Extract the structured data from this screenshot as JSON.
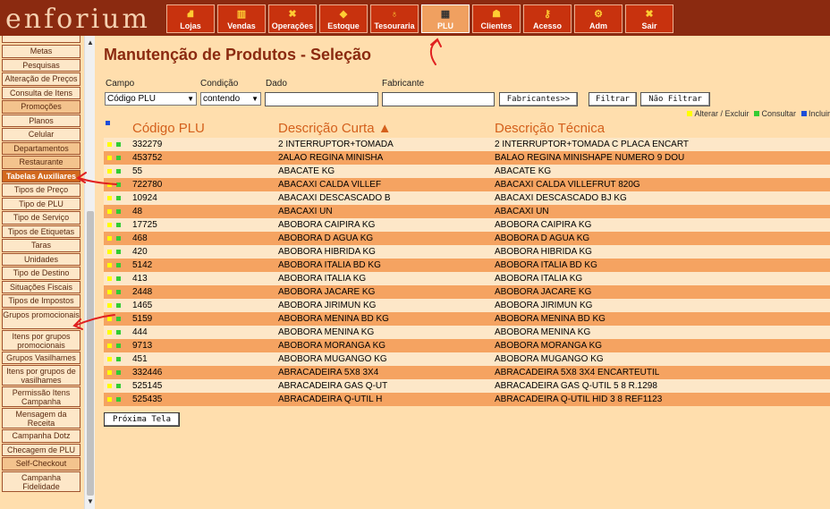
{
  "logo": "enforium",
  "nav": [
    {
      "label": "Lojas",
      "icon": "hierarchy-icon",
      "glyph": "⛘"
    },
    {
      "label": "Vendas",
      "icon": "bar-chart-icon",
      "glyph": "▥"
    },
    {
      "label": "Operações",
      "icon": "tools-icon",
      "glyph": "✖"
    },
    {
      "label": "Estoque",
      "icon": "boxes-icon",
      "glyph": "◆"
    },
    {
      "label": "Tesouraria",
      "icon": "money-bag-icon",
      "glyph": "♁"
    },
    {
      "label": "PLU",
      "icon": "barcode-icon",
      "glyph": "▦"
    },
    {
      "label": "Clientes",
      "icon": "people-icon",
      "glyph": "☗"
    },
    {
      "label": "Acesso",
      "icon": "key-icon",
      "glyph": "⚷"
    },
    {
      "label": "Adm",
      "icon": "gears-icon",
      "glyph": "⚙"
    },
    {
      "label": "Sair",
      "icon": "exit-icon",
      "glyph": "✖"
    }
  ],
  "sidebar": [
    {
      "label": "Metas"
    },
    {
      "label": "Pesquisas"
    },
    {
      "label": "Alteração de Preços"
    },
    {
      "label": "Consulta de Itens"
    },
    {
      "label": "Promoções",
      "style": "hl"
    },
    {
      "label": "Planos"
    },
    {
      "label": "Celular"
    },
    {
      "label": "Departamentos",
      "style": "hl"
    },
    {
      "label": "Restaurante",
      "style": "hl"
    },
    {
      "label": "Tabelas Auxiliares",
      "style": "sel"
    },
    {
      "label": "Tipos de Preço"
    },
    {
      "label": "Tipo de PLU"
    },
    {
      "label": "Tipo de Serviço"
    },
    {
      "label": "Tipos de Etiquetas"
    },
    {
      "label": "Taras"
    },
    {
      "label": "Unidades"
    },
    {
      "label": "Tipo de Destino"
    },
    {
      "label": "Situações Fiscais"
    },
    {
      "label": "Tipos de Impostos"
    },
    {
      "label": "Grupos promocionais",
      "tall": true
    },
    {
      "label": "Itens por grupos promocionais",
      "tall": true
    },
    {
      "label": "Grupos Vasilhames"
    },
    {
      "label": "Itens por grupos de vasilhames",
      "tall": true
    },
    {
      "label": "Permissão Itens Campanha",
      "tall": true
    },
    {
      "label": "Mensagem da Receita",
      "tall": true
    },
    {
      "label": "Campanha Dotz"
    },
    {
      "label": "Checagem de PLU"
    },
    {
      "label": "Self-Checkout",
      "style": "hl"
    },
    {
      "label": "Campanha Fidelidade",
      "tall": true
    }
  ],
  "main": {
    "title": "Manutenção de Produtos - Seleção",
    "filters": {
      "campo_label": "Campo",
      "campo_value": "Código PLU",
      "condicao_label": "Condição",
      "condicao_value": "contendo",
      "dado_label": "Dado",
      "dado_value": "",
      "fabricante_label": "Fabricante",
      "fabricante_value": "",
      "fabricantes_btn": "Fabricantes>>",
      "filtrar_btn": "Filtrar",
      "nao_filtrar_btn": "Não Filtrar"
    },
    "legend": {
      "alterar": "Alterar / Excluir",
      "consultar": "Consultar",
      "incluir": "Incluir"
    },
    "columns": [
      "Código PLU",
      "Descrição Curta ▲",
      "Descrição Técnica"
    ],
    "rows": [
      [
        "332279",
        "2 INTERRUPTOR+TOMADA",
        "2 INTERRUPTOR+TOMADA C PLACA ENCART"
      ],
      [
        "453752",
        "2ALAO REGINA MINISHA",
        "BALAO REGINA MINISHAPE NUMERO 9 DOU"
      ],
      [
        "55",
        "ABACATE KG",
        "ABACATE KG"
      ],
      [
        "722780",
        "ABACAXI CALDA VILLEF",
        "ABACAXI CALDA VILLEFRUT 820G"
      ],
      [
        "10924",
        "ABACAXI DESCASCADO B",
        "ABACAXI DESCASCADO BJ KG"
      ],
      [
        "48",
        "ABACAXI UN",
        "ABACAXI UN"
      ],
      [
        "17725",
        "ABOBORA CAIPIRA KG",
        "ABOBORA CAIPIRA KG"
      ],
      [
        "468",
        "ABOBORA D AGUA KG",
        "ABOBORA D AGUA KG"
      ],
      [
        "420",
        "ABOBORA HIBRIDA KG",
        "ABOBORA HIBRIDA KG"
      ],
      [
        "5142",
        "ABOBORA ITALIA BD KG",
        "ABOBORA ITALIA BD KG"
      ],
      [
        "413",
        "ABOBORA ITALIA KG",
        "ABOBORA ITALIA KG"
      ],
      [
        "2448",
        "ABOBORA JACARE KG",
        "ABOBORA JACARE KG"
      ],
      [
        "1465",
        "ABOBORA JIRIMUN KG",
        "ABOBORA JIRIMUN KG"
      ],
      [
        "5159",
        "ABOBORA MENINA BD KG",
        "ABOBORA MENINA BD KG"
      ],
      [
        "444",
        "ABOBORA MENINA KG",
        "ABOBORA MENINA KG"
      ],
      [
        "9713",
        "ABOBORA MORANGA KG",
        "ABOBORA MORANGA KG"
      ],
      [
        "451",
        "ABOBORA MUGANGO KG",
        "ABOBORA MUGANGO KG"
      ],
      [
        "332446",
        "ABRACADEIRA 5X8 3X4",
        "ABRACADEIRA 5X8 3X4 ENCARTEUTIL"
      ],
      [
        "525145",
        "ABRACADEIRA GAS Q-UT",
        "ABRACADEIRA GAS Q-UTIL 5 8 R.1298"
      ],
      [
        "525435",
        "ABRACADEIRA Q-UTIL H",
        "ABRACADEIRA Q-UTIL HID 3 8 REF1123"
      ]
    ],
    "next_btn": "Próxima Tela"
  },
  "colors": {
    "header_bg": "#8b2a10",
    "nav_btn": "#c8320e",
    "page_bg": "#ffdead",
    "row_light": "#fde7c8",
    "row_dark": "#f5a361",
    "title": "#8b2a10",
    "column_header": "#d4601c",
    "annotation": "#e02020"
  }
}
